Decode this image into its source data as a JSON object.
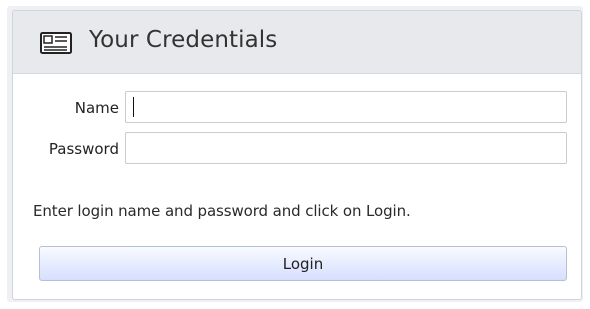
{
  "panel": {
    "title": "Your Credentials",
    "icon": "credentials-card-icon"
  },
  "form": {
    "name_label": "Name",
    "name_value": "",
    "password_label": "Password",
    "password_value": "",
    "hint": "Enter login name and password and click on Login.",
    "login_label": "Login"
  },
  "colors": {
    "header_background": "#e8e9ec",
    "button_top": "#f9fbff",
    "button_bottom": "#d6dfff",
    "border": "#cfd3da"
  }
}
